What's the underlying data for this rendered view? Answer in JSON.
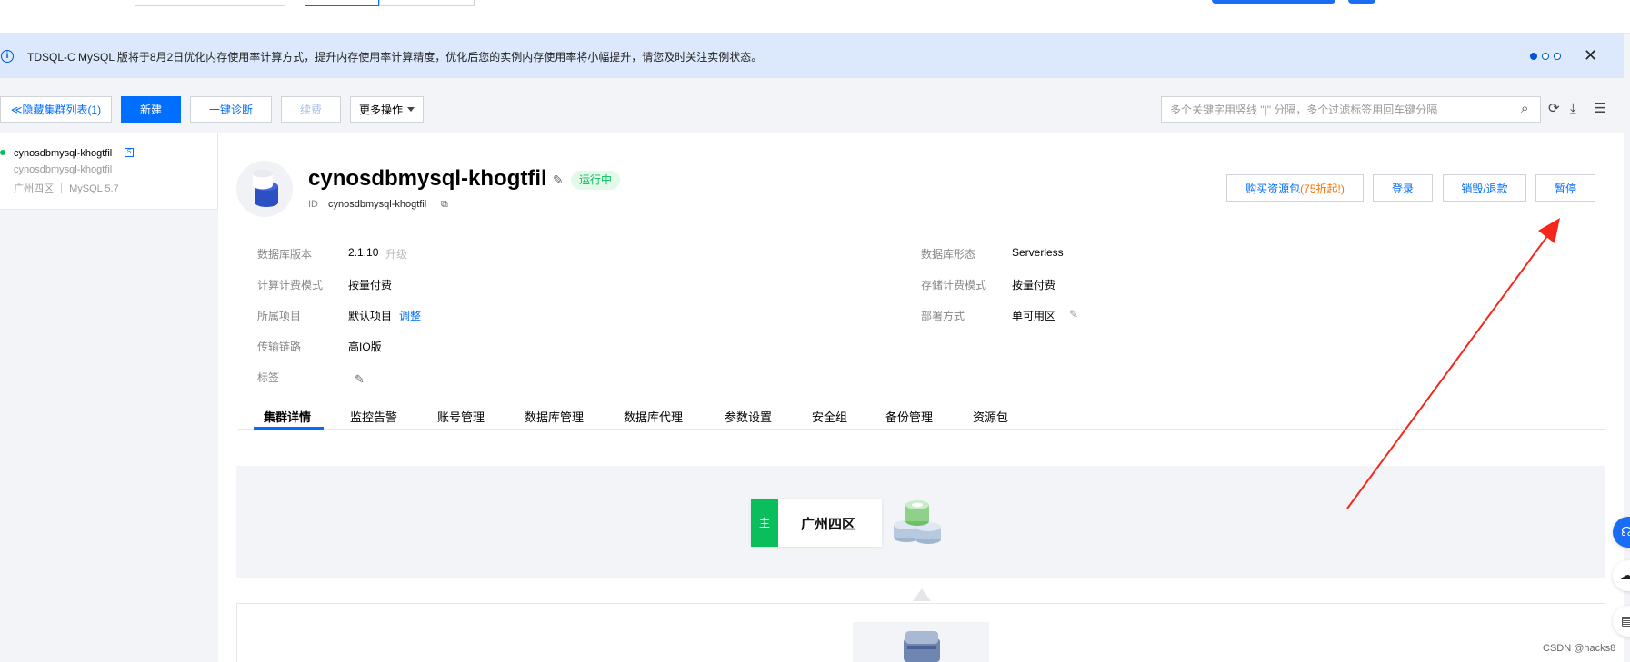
{
  "notice": {
    "text": "TDSQL-C MySQL 版将于8月2日优化内存使用率计算方式，提升内存使用率计算精度，优化后您的实例内存使用率将小幅提升，请您及时关注实例状态。",
    "icon": "info-icon",
    "close": "✕"
  },
  "toolbar": {
    "hide_list": "≪隐藏集群列表(1)",
    "new": "新建",
    "diagnose": "一键诊断",
    "renew": "续费",
    "more": "更多操作",
    "search_placeholder": "多个关键字用竖线 \"|\" 分隔，多个过滤标签用回车键分隔",
    "icons": {
      "search": "⌕",
      "refresh": "⟳",
      "download": "⤓",
      "settings": "☰"
    }
  },
  "cluster_list": [
    {
      "name": "cynosdbmysql-khogtfil",
      "id": "cynosdbmysql-khogtfil",
      "meta": "广州四区 ｜ MySQL 5.7"
    }
  ],
  "cluster": {
    "name": "cynosdbmysql-khogtfil",
    "status": "运行中",
    "id_label": "ID",
    "id": "cynosdbmysql-khogtfil"
  },
  "actions": {
    "buy": "购买资源包",
    "buy_discount": "(75折起!)",
    "login": "登录",
    "destroy": "销毁/退款",
    "pause": "暂停"
  },
  "info_left": [
    {
      "key": "数据库版本",
      "value": "2.1.10",
      "extra": "升级"
    },
    {
      "key": "计算计费模式",
      "value": "按量付费"
    },
    {
      "key": "所属项目",
      "value": "默认项目",
      "link": "调整"
    },
    {
      "key": "传输链路",
      "value": "高IO版"
    },
    {
      "key": "标签",
      "value": ""
    }
  ],
  "info_right": [
    {
      "key": "数据库形态",
      "value": "Serverless"
    },
    {
      "key": "存储计费模式",
      "value": "按量付费"
    },
    {
      "key": "部署方式",
      "value": "单可用区"
    }
  ],
  "tabs": [
    "集群详情",
    "监控告警",
    "账号管理",
    "数据库管理",
    "数据库代理",
    "参数设置",
    "安全组",
    "备份管理",
    "资源包"
  ],
  "topology": {
    "tag": "主",
    "region": "广州四区"
  },
  "watermark": "CSDN @hacks8",
  "colors": {
    "primary": "#006eff",
    "success": "#0abf5b",
    "notice_bg": "#dce9fd",
    "annotation_arrow": "#f5271c"
  }
}
